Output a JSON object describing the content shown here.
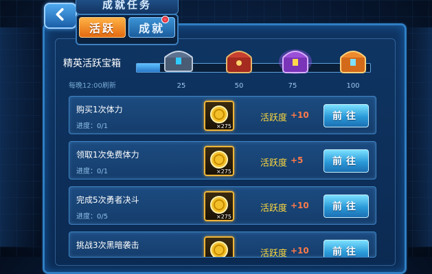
{
  "header": {
    "title": "成就任务",
    "back_icon": "back-arrow-icon"
  },
  "tabs": [
    {
      "label": "活跃",
      "active": true
    },
    {
      "label": "成就",
      "active": false,
      "badge": true
    }
  ],
  "chest_section": {
    "title": "精英活跃宝箱",
    "refresh_text": "每晚12:00刷新",
    "progress": 0.1,
    "chests": [
      {
        "value": "25",
        "color": "#6a7d96"
      },
      {
        "value": "50",
        "color": "#c0392b"
      },
      {
        "value": "75",
        "color": "#8e44ad"
      },
      {
        "value": "100",
        "color": "#e67e22"
      }
    ]
  },
  "tasks": [
    {
      "name": "购买1次体力",
      "progress": "进度：0/1",
      "coin_count": "×275",
      "reward_label": "活跃度",
      "reward_value": "+10",
      "button": "前往"
    },
    {
      "name": "领取1次免费体力",
      "progress": "进度：0/1",
      "coin_count": "×275",
      "reward_label": "活跃度",
      "reward_value": "+5",
      "button": "前往"
    },
    {
      "name": "完成5次勇者决斗",
      "progress": "进度：0/5",
      "coin_count": "×275",
      "reward_label": "活跃度",
      "reward_value": "+10",
      "button": "前往"
    },
    {
      "name": "挑战3次黑暗袭击",
      "progress": "",
      "coin_count": "",
      "reward_label": "活跃度",
      "reward_value": "+10",
      "button": "前往"
    }
  ]
}
